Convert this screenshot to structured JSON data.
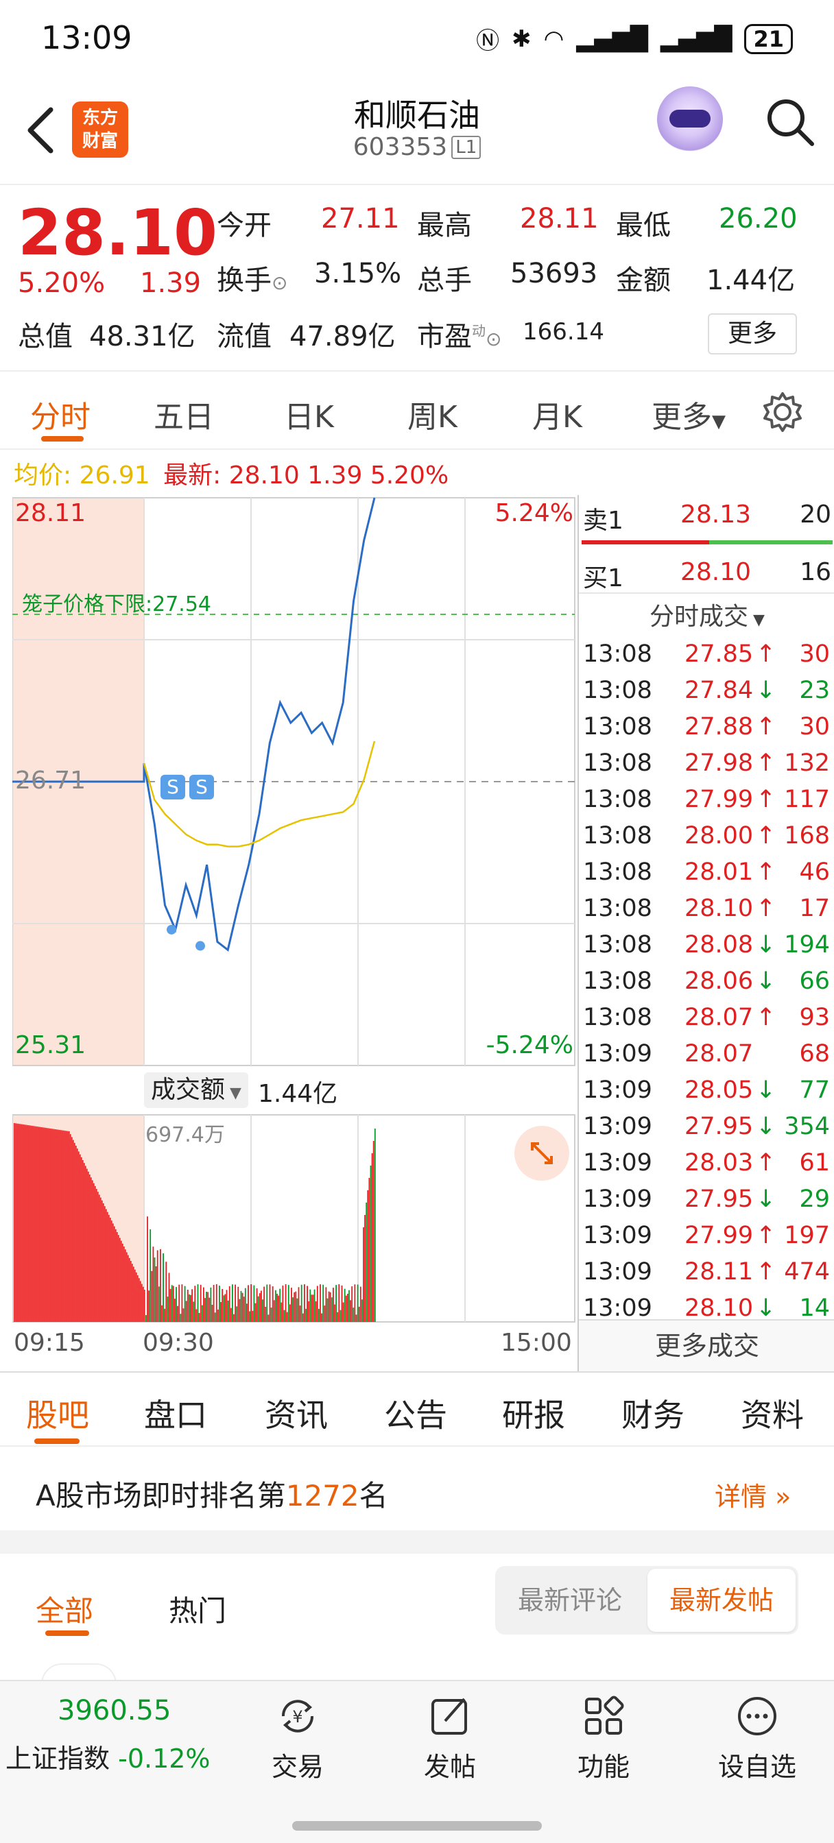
{
  "status": {
    "time": "13:09",
    "battery": "21"
  },
  "header": {
    "name": "和顺石油",
    "code": "603353",
    "code_tag": "L1",
    "logo_line1": "东方",
    "logo_line2": "财富"
  },
  "quote": {
    "price": "28.10",
    "change_pct": "5.20%",
    "change": "1.39",
    "open_label": "今开",
    "open": "27.11",
    "high_label": "最高",
    "high": "28.11",
    "low_label": "最低",
    "low": "26.20",
    "turnover_label": "换手",
    "turnover": "3.15%",
    "volume_label": "总手",
    "volume": "53693",
    "amount_label": "金额",
    "amount": "1.44亿",
    "mcap_label": "总值",
    "mcap": "48.31亿",
    "float_label": "流值",
    "float_cap": "47.89亿",
    "pe_label": "市盈",
    "pe_sup": "动",
    "pe": "166.14",
    "more": "更多"
  },
  "chart_tabs": [
    "分时",
    "五日",
    "日K",
    "周K",
    "月K",
    "更多"
  ],
  "info": {
    "avg_label": "均价:",
    "avg": "26.91",
    "latest_label": "最新:",
    "latest": "28.10 1.39 5.20%"
  },
  "chart": {
    "y_top": "28.11",
    "y_mid": "26.71",
    "y_bottom": "25.31",
    "pct_top": "5.24%",
    "pct_bottom": "-5.24%",
    "cage_label": "笼子价格下限:27.54",
    "vol_label": "成交额",
    "vol_total": "1.44亿",
    "vol_max": "697.4万",
    "x_labels": [
      "09:15",
      "09:30",
      "15:00"
    ],
    "signals": [
      "S",
      "S"
    ]
  },
  "chart_data": {
    "type": "line",
    "ylim": [
      25.31,
      28.11
    ],
    "series": [
      {
        "values": [
          26.8,
          26.5,
          26.1,
          25.98,
          26.2,
          26.05,
          26.3,
          25.92,
          25.88,
          26.1,
          26.3,
          26.55,
          26.9,
          27.1,
          27.0,
          27.05,
          26.95,
          27.0,
          26.9,
          27.1,
          27.6,
          27.9,
          28.11
        ]
      },
      {
        "values": [
          26.8,
          26.62,
          26.55,
          26.5,
          26.45,
          26.42,
          26.4,
          26.4,
          26.39,
          26.39,
          26.4,
          26.42,
          26.45,
          26.48,
          26.5,
          26.52,
          26.53,
          26.54,
          26.55,
          26.56,
          26.6,
          26.72,
          26.91
        ]
      }
    ]
  },
  "orderbook": {
    "ask_label": "卖1",
    "ask_price": "28.13",
    "ask_vol": "20",
    "bid_label": "买1",
    "bid_price": "28.10",
    "bid_vol": "16",
    "trades_title": "分时成交"
  },
  "trades": [
    {
      "time": "13:08",
      "price": "27.85",
      "dir": "up",
      "vol": "30"
    },
    {
      "time": "13:08",
      "price": "27.84",
      "dir": "down",
      "vol": "23"
    },
    {
      "time": "13:08",
      "price": "27.88",
      "dir": "up",
      "vol": "30"
    },
    {
      "time": "13:08",
      "price": "27.98",
      "dir": "up",
      "vol": "132"
    },
    {
      "time": "13:08",
      "price": "27.99",
      "dir": "up",
      "vol": "117"
    },
    {
      "time": "13:08",
      "price": "28.00",
      "dir": "up",
      "vol": "168"
    },
    {
      "time": "13:08",
      "price": "28.01",
      "dir": "up",
      "vol": "46"
    },
    {
      "time": "13:08",
      "price": "28.10",
      "dir": "up",
      "vol": "17"
    },
    {
      "time": "13:08",
      "price": "28.08",
      "dir": "down",
      "vol": "194"
    },
    {
      "time": "13:08",
      "price": "28.06",
      "dir": "down",
      "vol": "66"
    },
    {
      "time": "13:08",
      "price": "28.07",
      "dir": "up",
      "vol": "93"
    },
    {
      "time": "13:09",
      "price": "28.07",
      "dir": "none",
      "vol": "68"
    },
    {
      "time": "13:09",
      "price": "28.05",
      "dir": "down",
      "vol": "77"
    },
    {
      "time": "13:09",
      "price": "27.95",
      "dir": "down",
      "vol": "354"
    },
    {
      "time": "13:09",
      "price": "28.03",
      "dir": "up",
      "vol": "61"
    },
    {
      "time": "13:09",
      "price": "27.95",
      "dir": "down",
      "vol": "29"
    },
    {
      "time": "13:09",
      "price": "27.99",
      "dir": "up",
      "vol": "197"
    },
    {
      "time": "13:09",
      "price": "28.11",
      "dir": "up",
      "vol": "474"
    },
    {
      "time": "13:09",
      "price": "28.10",
      "dir": "down",
      "vol": "14"
    }
  ],
  "more_trades": "更多成交",
  "section_tabs": [
    "股吧",
    "盘口",
    "资讯",
    "公告",
    "研报",
    "财务",
    "资料"
  ],
  "rank": {
    "prefix": "A股市场即时排名第",
    "num": "1272",
    "suffix": "名",
    "details": "详情"
  },
  "post_tabs": [
    "全部",
    "热门"
  ],
  "post_sort": [
    "最新评论",
    "最新发帖"
  ],
  "bottom": {
    "index_value": "3960.55",
    "index_name": "上证指数",
    "index_change": "-0.12%",
    "nav": [
      "交易",
      "发帖",
      "功能",
      "设自选"
    ]
  },
  "colors": {
    "up": "#e02020",
    "down": "#0a9a2a",
    "accent": "#e8600a"
  }
}
